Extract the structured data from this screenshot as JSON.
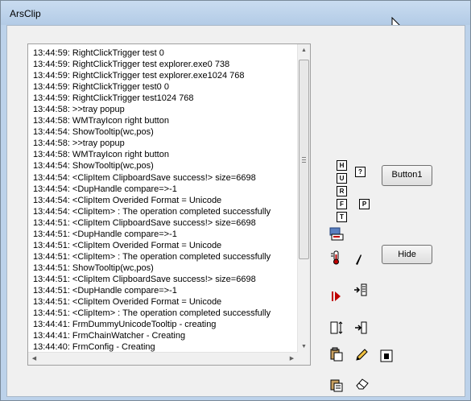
{
  "window": {
    "title": "ArsClip"
  },
  "log": {
    "lines": [
      "13:44:59: RightClickTrigger test 0",
      "13:44:59: RightClickTrigger test explorer.exe0 738",
      "13:44:59: RightClickTrigger test explorer.exe1024 768",
      "13:44:59: RightClickTrigger test0 0",
      "13:44:59: RightClickTrigger test1024 768",
      "13:44:58: >>tray popup",
      "13:44:58: WMTrayIcon right button",
      "13:44:54: ShowTooltip(wc,pos)",
      "13:44:58: >>tray popup",
      "13:44:58: WMTrayIcon right button",
      "13:44:54: ShowTooltip(wc,pos)",
      "13:44:54: <ClipItem ClipboardSave success!> size=6698",
      "13:44:54: <DupHandle compare=>-1",
      "13:44:54: <ClipItem Overided Format = Unicode",
      "13:44:54: <ClipItem>  : The operation completed successfully",
      "13:44:51: <ClipItem ClipboardSave success!> size=6698",
      "13:44:51: <DupHandle compare=>-1",
      "13:44:51: <ClipItem Overided Format = Unicode",
      "13:44:51: <ClipItem>  : The operation completed successfully",
      "13:44:51: ShowTooltip(wc,pos)",
      "13:44:51: <ClipItem ClipboardSave success!> size=6698",
      "13:44:51: <DupHandle compare=>-1",
      "13:44:51: <ClipItem Overided Format = Unicode",
      "13:44:51: <ClipItem>  : The operation completed successfully",
      "13:44:41: FrmDummyUnicodeTooltip - creating",
      "13:44:41: FrmChainWatcher - Creating",
      "13:44:40: FrmConfig - Creating"
    ]
  },
  "scrollbar": {
    "up": "▲",
    "down": "▼",
    "left": "◀",
    "right": "▶"
  },
  "buttons": {
    "button1": "Button1",
    "hide": "Hide"
  },
  "small_buttons": {
    "h": "H",
    "u": "U",
    "r": "R",
    "f": "F",
    "t": "T",
    "question": "?",
    "p": "P"
  },
  "icons": [
    "cursor-arrow-icon",
    "clipboard-list-icon",
    "thermometer-icon",
    "pen-nib-icon",
    "red-arrow-icon",
    "align-right-icon",
    "column-resize-icon",
    "split-cursor-icon",
    "paste-icon",
    "pencil-icon",
    "document-icon",
    "paste-special-icon",
    "eraser-icon"
  ]
}
